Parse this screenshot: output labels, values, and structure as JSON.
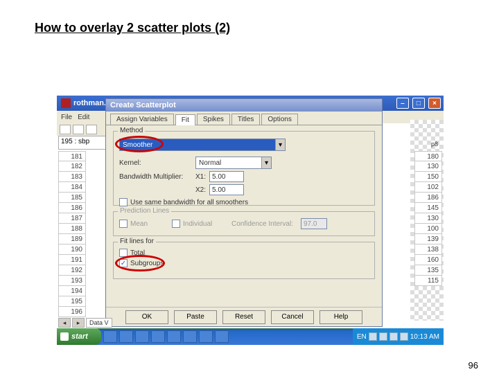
{
  "slide": {
    "title": "How to overlay 2 scatter plots (2)",
    "page_number": "96"
  },
  "app_window": {
    "title": "rothman.s",
    "menu": [
      "File",
      "Edit"
    ],
    "cell_indicator": "195 : sbp",
    "close_label": "×",
    "max_label": "□",
    "min_label": "–"
  },
  "grid": {
    "left_rows": [
      "181",
      "182",
      "183",
      "184",
      "185",
      "186",
      "187",
      "188",
      "189",
      "190",
      "191",
      "192",
      "193",
      "194",
      "195",
      "196"
    ],
    "right_header": "p8",
    "right_rows": [
      "180",
      "130",
      "150",
      "102",
      "186",
      "145",
      "130",
      "100",
      "139",
      "138",
      "160",
      "135",
      "115"
    ]
  },
  "status_views": {
    "label": "Data V"
  },
  "dialog": {
    "title": "Create Scatterplot",
    "tabs": [
      "Assign Variables",
      "Fit",
      "Spikes",
      "Titles",
      "Options"
    ],
    "active_tab": "Fit",
    "method_group": {
      "title": "Method",
      "method_value": "Smoother",
      "kernel_label": "Kernel:",
      "kernel_value": "Normal",
      "bw_label": "Bandwidth Multiplier:",
      "x1_label": "X1:",
      "x1_value": "5.00",
      "x2_label": "X2:",
      "x2_value": "5.00",
      "same_bw_label": "Use same bandwidth for all smoothers"
    },
    "predict_group": {
      "title": "Prediction Lines",
      "mean_label": "Mean",
      "individual_label": "Individual",
      "ci_label": "Confidence Interval:",
      "ci_value": "97.0"
    },
    "fitlines_group": {
      "title": "Fit lines for",
      "total_label": "Total",
      "subgroups_label": "Subgroups",
      "subgroups_checked": true
    },
    "buttons": {
      "ok": "OK",
      "paste": "Paste",
      "reset": "Reset",
      "cancel": "Cancel",
      "help": "Help"
    }
  },
  "taskbar": {
    "start": "start",
    "items": [
      "W",
      "S",
      "X",
      "X",
      "S",
      "X"
    ],
    "tray": {
      "lang": "EN",
      "time": "10:13 AM"
    }
  }
}
